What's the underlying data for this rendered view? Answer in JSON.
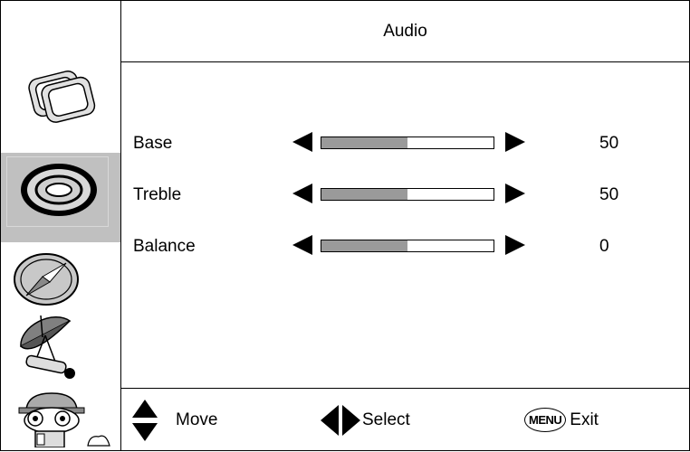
{
  "header": {
    "title": "Audio"
  },
  "settings": [
    {
      "label": "Base",
      "value": "50",
      "level": 0.5
    },
    {
      "label": "Treble",
      "value": "50",
      "level": 0.5
    },
    {
      "label": "Balance",
      "value": "0",
      "level": 0.5
    }
  ],
  "footer": {
    "move_label": "Move",
    "select_label": "Select",
    "menu_key": "MENU",
    "exit_label": "Exit"
  },
  "sidebar": {
    "icons": [
      "picture-icon",
      "audio-icon",
      "compass-icon",
      "satellite-icon",
      "character-icon"
    ],
    "selected": "audio-icon"
  },
  "colors": {
    "selected_bg": "#c0c0c0",
    "slider_fill": "#9a9a9a"
  }
}
